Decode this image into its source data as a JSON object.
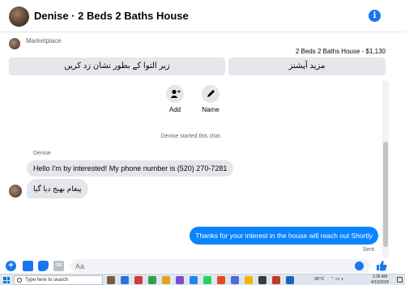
{
  "header": {
    "title": "Denise · 2 Beds 2 Baths House",
    "info_glyph": "i"
  },
  "marketplace": {
    "label": "Marketplace",
    "item_title": "2 Beds 2 Baths House - $1,130",
    "buttons": [
      {
        "label": "زیر التوا کے بطور نشان زد کریں"
      },
      {
        "label": "مزید آپشنز"
      }
    ]
  },
  "actions": [
    {
      "label": "Add",
      "icon": "add-person-icon"
    },
    {
      "label": "Name",
      "icon": "pencil-icon"
    }
  ],
  "chat": {
    "system_message": "Denise started this chat.",
    "sender_name": "Denise",
    "incoming": [
      "Hello I'm by interested! My phone number is (520) 270-7281",
      "پیغام بھیج دیا گیا"
    ],
    "outgoing": "Thanks for your interest in the house will reach out Shortly",
    "sent_status": "Sent"
  },
  "composer": {
    "placeholder": "Aa",
    "gif_label": "GIF"
  },
  "taskbar": {
    "search_placeholder": "Type here to search",
    "weather": "30°C",
    "time": "1:06 AM",
    "date": "4/15/2025",
    "app_colors": [
      "#7a5b3a",
      "#2f6fd6",
      "#d13b3b",
      "#2e9e4f",
      "#e3a21a",
      "#7b49d6",
      "#1e88e5",
      "#25d366",
      "#e04a2a",
      "#4d6bd8",
      "#f2b705",
      "#3a3a3a",
      "#c0392b",
      "#1565c0"
    ]
  },
  "colors": {
    "accent": "#1877f2",
    "outgoing_bubble": "#0b84ff",
    "incoming_bubble": "#e4e6eb"
  }
}
